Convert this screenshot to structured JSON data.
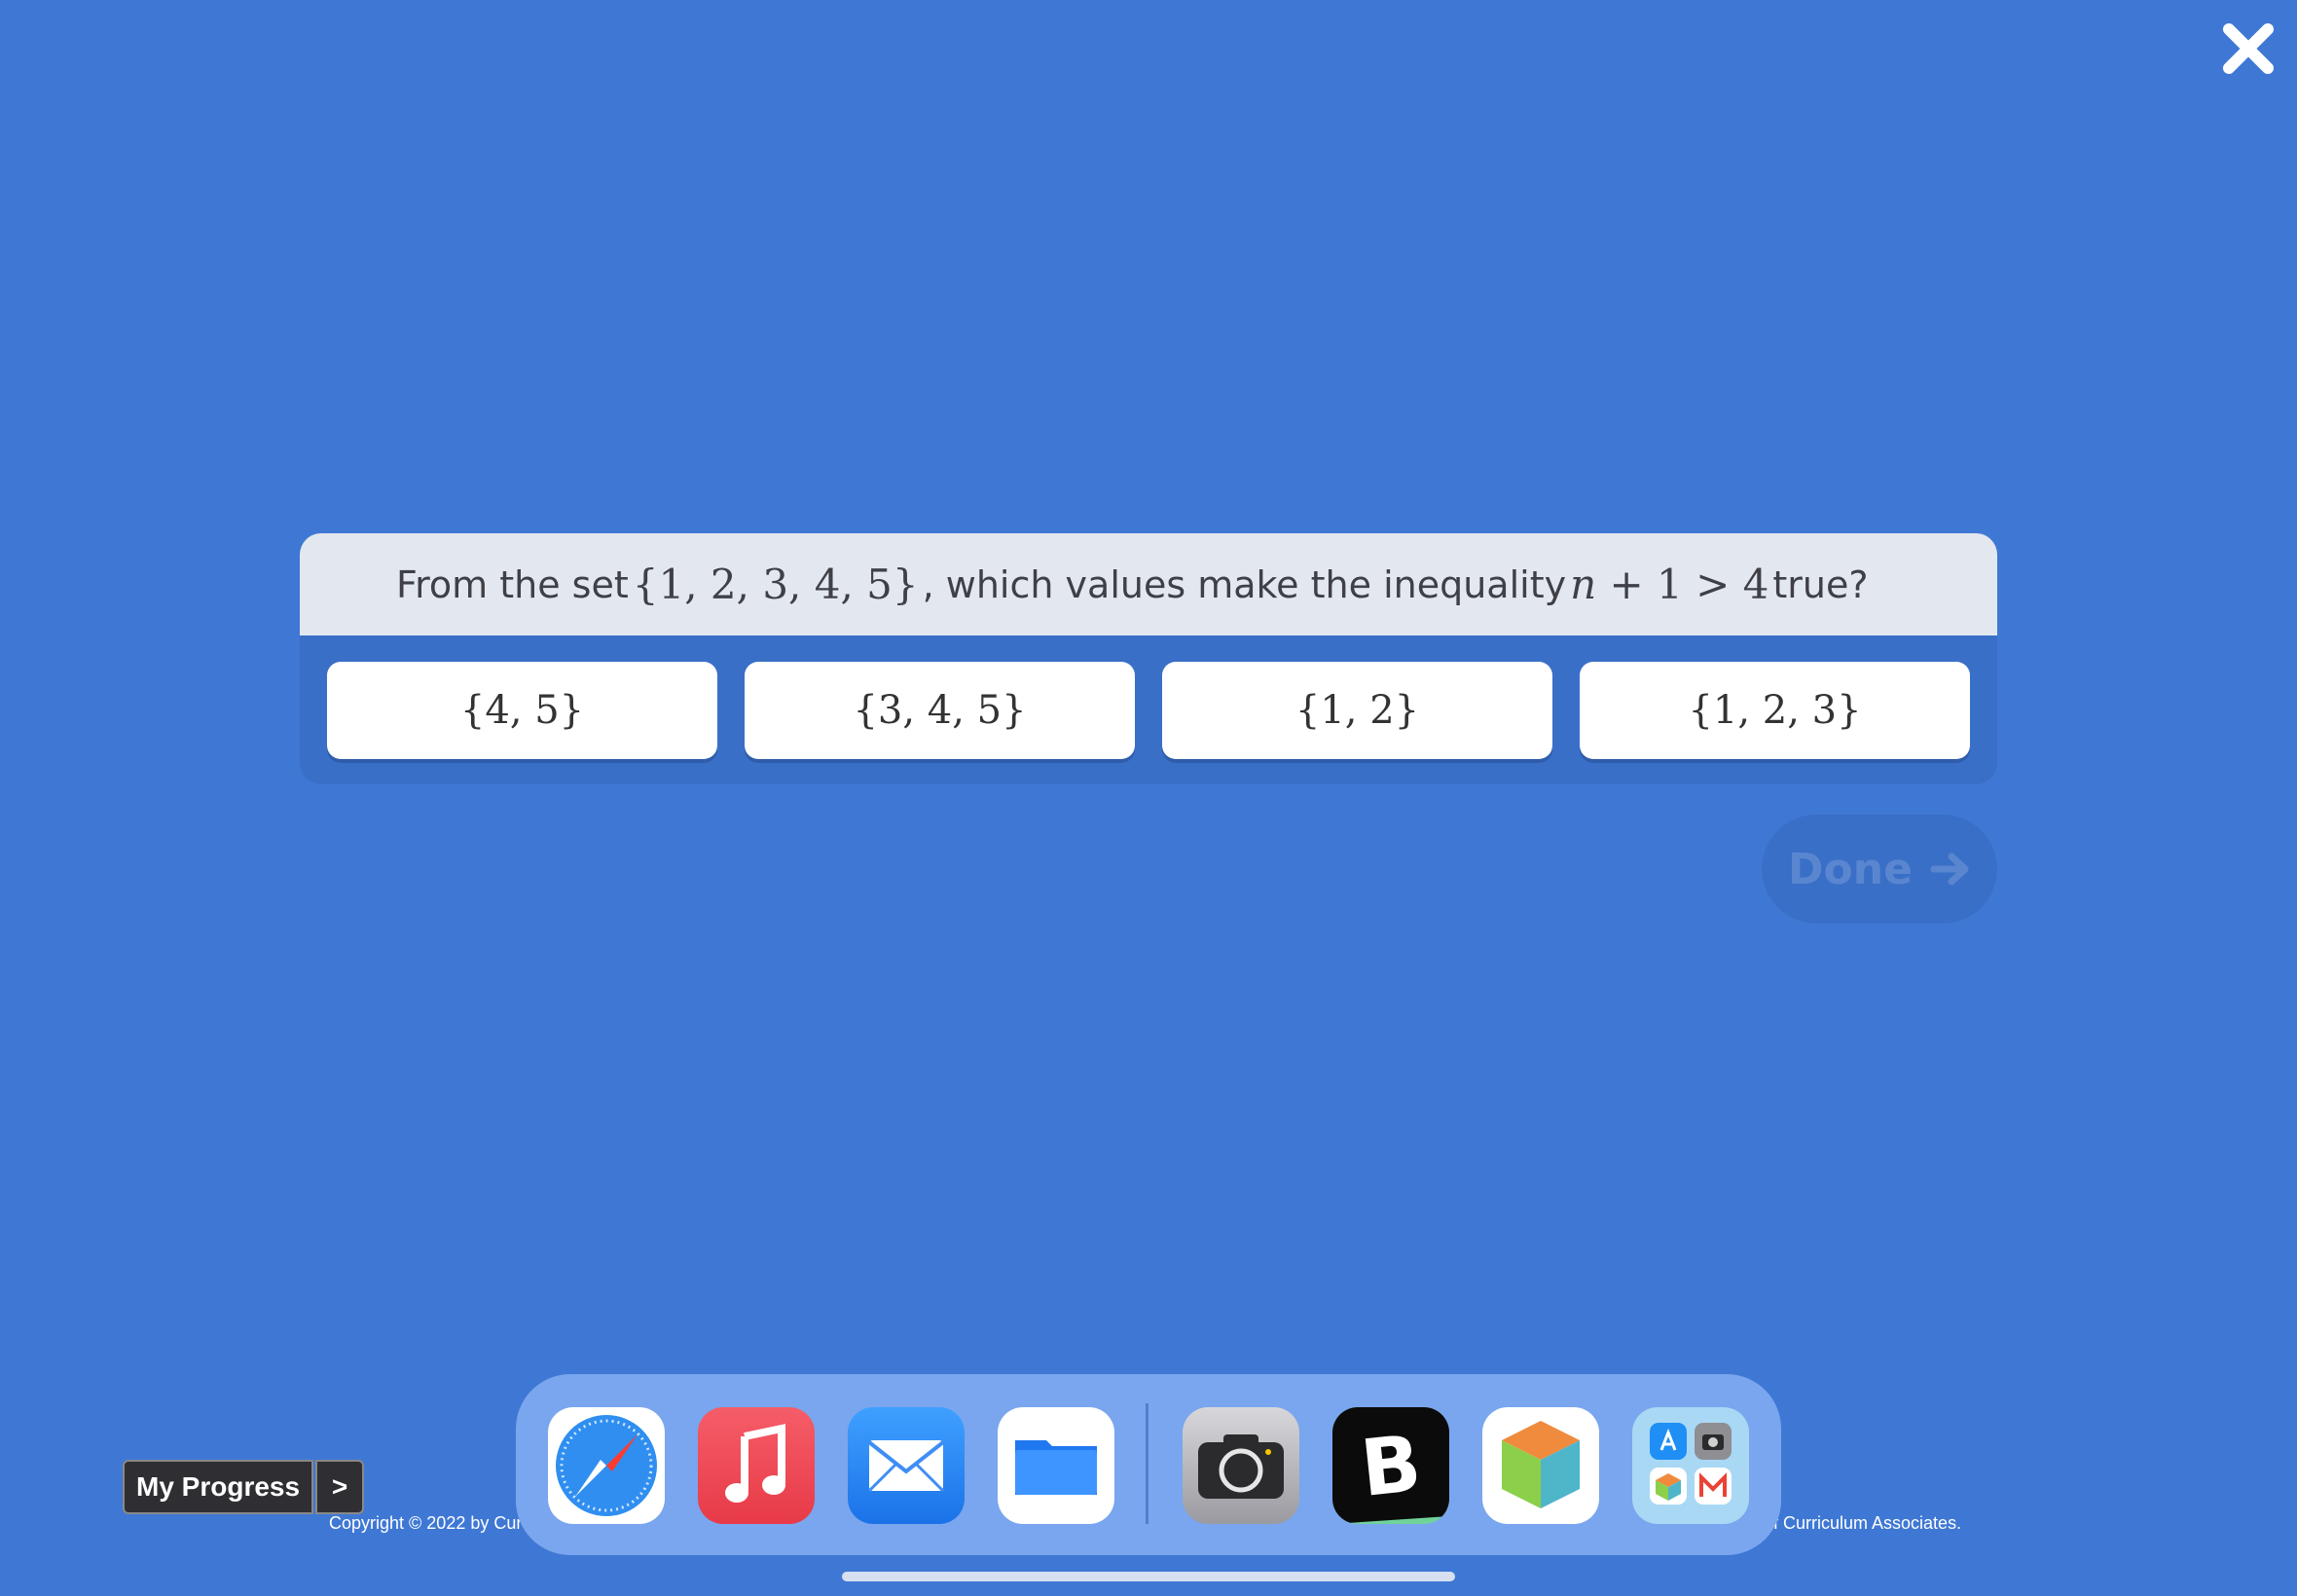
{
  "question": {
    "prefix": "From the set ",
    "set_expr": "{1, 2, 3, 4, 5}",
    "middle": ", which values make the inequality ",
    "ineq_var": "n",
    "ineq_rest": " + 1 > 4",
    "suffix": " true?"
  },
  "answers": [
    {
      "label": "{4, 5}"
    },
    {
      "label": "{3, 4, 5}"
    },
    {
      "label": "{1, 2}"
    },
    {
      "label": "{1, 2, 3}"
    }
  ],
  "done": {
    "label": "Done"
  },
  "progress": {
    "label": "My Progress",
    "arrow": ">"
  },
  "copyright": {
    "left": "Copyright © 2022 by Cur",
    "right": "of Curriculum Associates."
  },
  "dock": {
    "apps": [
      "safari-icon",
      "music-icon",
      "mail-icon",
      "files-icon",
      "camera-icon",
      "blooket-icon",
      "cube-app-icon",
      "app-library-icon"
    ]
  },
  "colors": {
    "background": "#3f78d4",
    "question_bar": "#e3e8f0",
    "card": "#3a6fc7",
    "dock": "#79a6ee"
  }
}
